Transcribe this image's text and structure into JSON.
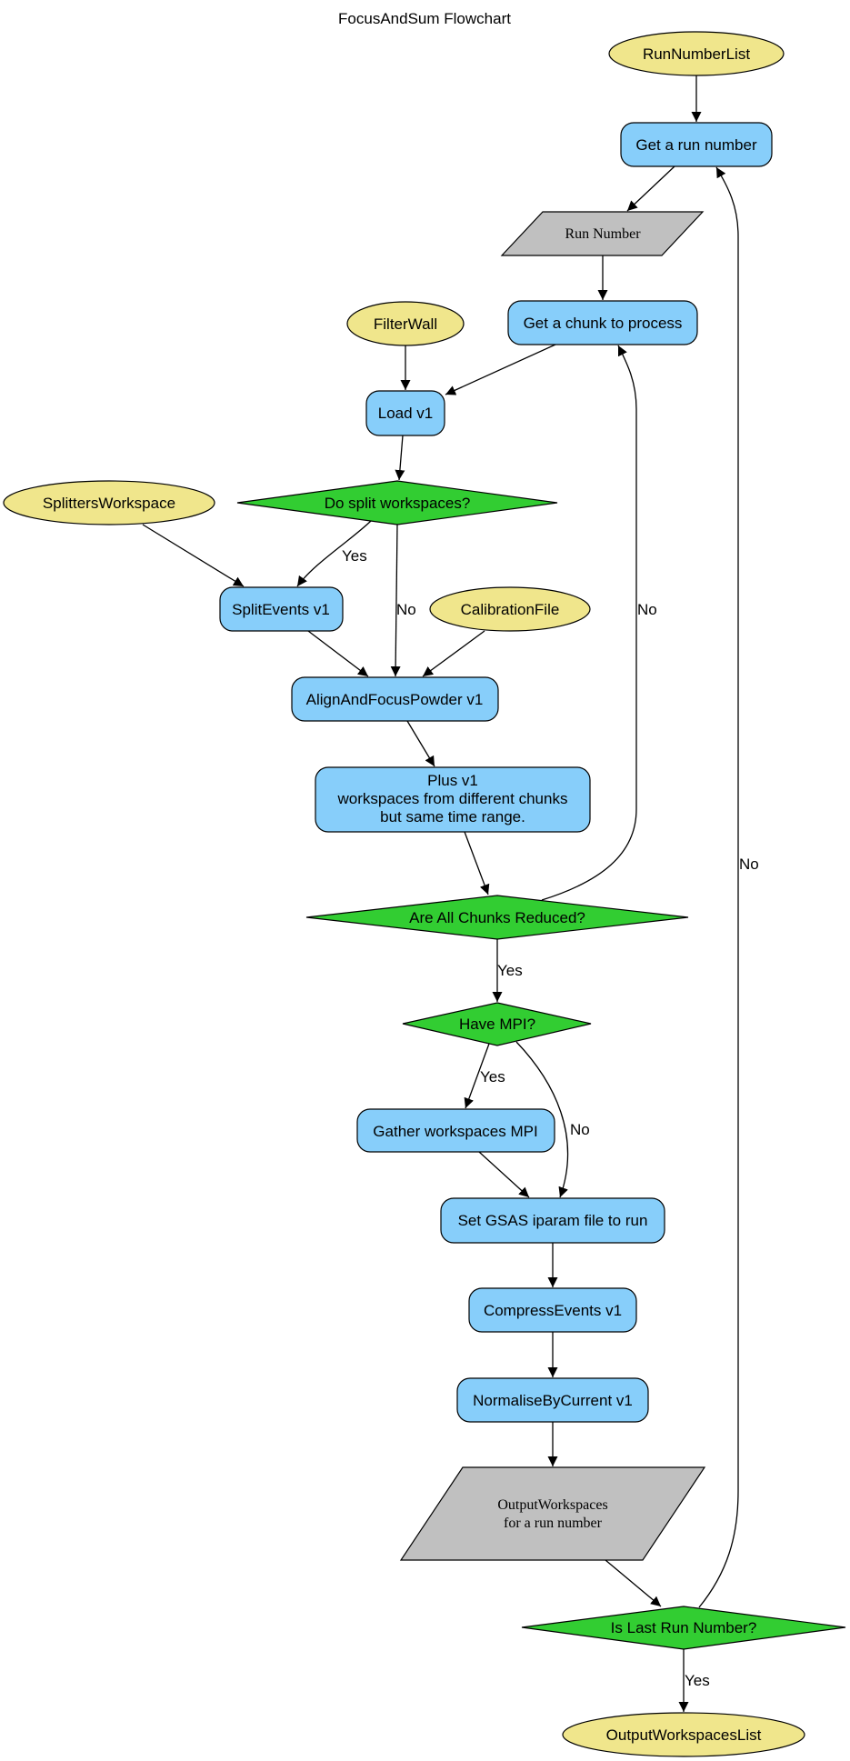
{
  "title": "FocusAndSum Flowchart",
  "colors": {
    "input": "#F0E68C",
    "process": "#87CEFA",
    "decision": "#32CD32",
    "data": "#C0C0C0"
  },
  "nodes": {
    "run_number_list": "RunNumberList",
    "get_run_number": "Get a run number",
    "run_number": "Run Number",
    "filter_wall": "FilterWall",
    "get_chunk": "Get a chunk to process",
    "load": "Load v1",
    "splitters_workspace": "SplittersWorkspace",
    "do_split": "Do split workspaces?",
    "split_events": "SplitEvents v1",
    "calibration_file": "CalibrationFile",
    "align_focus": "AlignAndFocusPowder v1",
    "plus": [
      "Plus v1",
      "workspaces from different chunks",
      "but same time range."
    ],
    "all_chunks": "Are All Chunks Reduced?",
    "have_mpi": "Have MPI?",
    "gather": "Gather workspaces MPI",
    "set_gsas": "Set GSAS iparam file to run",
    "compress": "CompressEvents v1",
    "normalise": "NormaliseByCurrent v1",
    "output_ws": [
      "OutputWorkspaces",
      "for a run number"
    ],
    "is_last_run": "Is Last Run Number?",
    "output_ws_list": "OutputWorkspacesList"
  },
  "edge_labels": {
    "split_yes": "Yes",
    "split_no": "No",
    "chunks_no": "No",
    "chunks_yes": "Yes",
    "mpi_yes": "Yes",
    "mpi_no": "No",
    "last_run_no": "No",
    "last_run_yes": "Yes"
  }
}
